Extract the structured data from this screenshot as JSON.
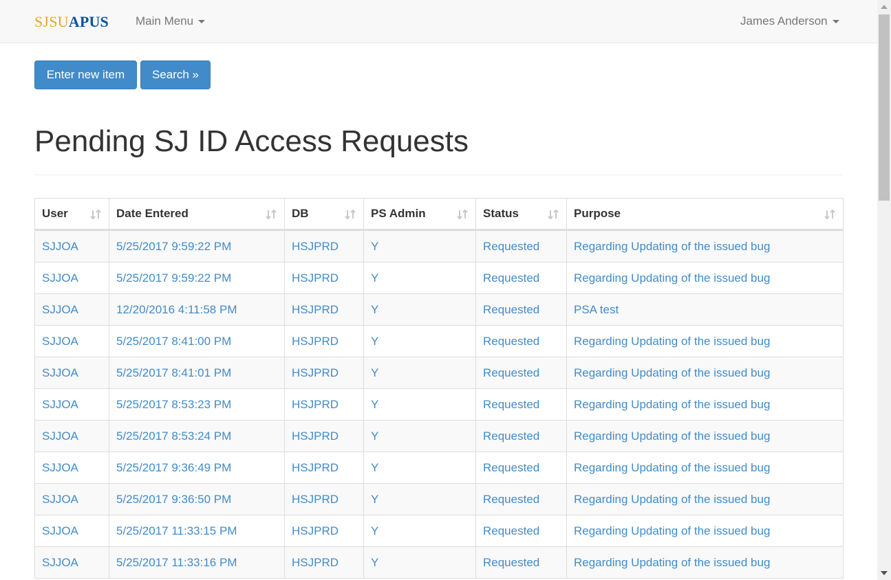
{
  "brand": {
    "part1": "SJSU",
    "part2": "APUS"
  },
  "nav": {
    "main_menu": "Main Menu",
    "user": "James Anderson"
  },
  "buttons": {
    "new_item": "Enter new item",
    "search": "Search »"
  },
  "page_title": "Pending SJ ID Access Requests",
  "table": {
    "columns": [
      "User",
      "Date Entered",
      "DB",
      "PS Admin",
      "Status",
      "Purpose"
    ],
    "rows": [
      [
        "SJJOA",
        "5/25/2017 9:59:22 PM",
        "HSJPRD",
        "Y",
        "Requested",
        "Regarding Updating of the issued bug"
      ],
      [
        "SJJOA",
        "5/25/2017 9:59:22 PM",
        "HSJPRD",
        "Y",
        "Requested",
        "Regarding Updating of the issued bug"
      ],
      [
        "SJJOA",
        "12/20/2016 4:11:58 PM",
        "HSJPRD",
        "Y",
        "Requested",
        "PSA test"
      ],
      [
        "SJJOA",
        "5/25/2017 8:41:00 PM",
        "HSJPRD",
        "Y",
        "Requested",
        "Regarding Updating of the issued bug"
      ],
      [
        "SJJOA",
        "5/25/2017 8:41:01 PM",
        "HSJPRD",
        "Y",
        "Requested",
        "Regarding Updating of the issued bug"
      ],
      [
        "SJJOA",
        "5/25/2017 8:53:23 PM",
        "HSJPRD",
        "Y",
        "Requested",
        "Regarding Updating of the issued bug"
      ],
      [
        "SJJOA",
        "5/25/2017 8:53:24 PM",
        "HSJPRD",
        "Y",
        "Requested",
        "Regarding Updating of the issued bug"
      ],
      [
        "SJJOA",
        "5/25/2017 9:36:49 PM",
        "HSJPRD",
        "Y",
        "Requested",
        "Regarding Updating of the issued bug"
      ],
      [
        "SJJOA",
        "5/25/2017 9:36:50 PM",
        "HSJPRD",
        "Y",
        "Requested",
        "Regarding Updating of the issued bug"
      ],
      [
        "SJJOA",
        "5/25/2017 11:33:15 PM",
        "HSJPRD",
        "Y",
        "Requested",
        "Regarding Updating of the issued bug"
      ],
      [
        "SJJOA",
        "5/25/2017 11:33:16 PM",
        "HSJPRD",
        "Y",
        "Requested",
        "Regarding Updating of the issued bug"
      ]
    ]
  },
  "colors": {
    "primary": "#428bca",
    "brand_gold": "#e5a823",
    "brand_blue": "#0055a2"
  }
}
